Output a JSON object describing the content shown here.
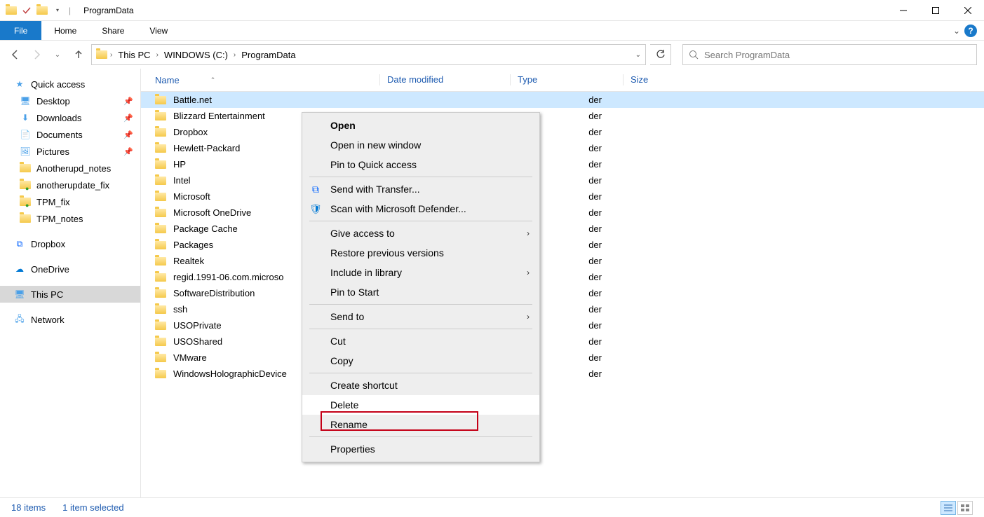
{
  "window": {
    "title": "ProgramData"
  },
  "ribbon": {
    "file": "File",
    "tabs": [
      "Home",
      "Share",
      "View"
    ]
  },
  "breadcrumb": [
    "This PC",
    "WINDOWS (C:)",
    "ProgramData"
  ],
  "search": {
    "placeholder": "Search ProgramData"
  },
  "sidebar": {
    "quick_access": {
      "label": "Quick access",
      "items": [
        {
          "label": "Desktop",
          "pinned": true,
          "icon": "desktop"
        },
        {
          "label": "Downloads",
          "pinned": true,
          "icon": "downloads"
        },
        {
          "label": "Documents",
          "pinned": true,
          "icon": "documents"
        },
        {
          "label": "Pictures",
          "pinned": true,
          "icon": "pictures"
        },
        {
          "label": "Anotherupd_notes",
          "pinned": false,
          "icon": "folder"
        },
        {
          "label": "anotherupdate_fix",
          "pinned": false,
          "icon": "folder-check"
        },
        {
          "label": "TPM_fix",
          "pinned": false,
          "icon": "folder-check"
        },
        {
          "label": "TPM_notes",
          "pinned": false,
          "icon": "folder"
        }
      ]
    },
    "dropbox": {
      "label": "Dropbox"
    },
    "onedrive": {
      "label": "OneDrive"
    },
    "this_pc": {
      "label": "This PC"
    },
    "network": {
      "label": "Network"
    }
  },
  "columns": {
    "name": "Name",
    "date": "Date modified",
    "type": "Type",
    "size": "Size"
  },
  "files": [
    {
      "name": "Battle.net",
      "type_suffix": "der",
      "selected": true
    },
    {
      "name": "Blizzard Entertainment",
      "type_suffix": "der"
    },
    {
      "name": "Dropbox",
      "type_suffix": "der"
    },
    {
      "name": "Hewlett-Packard",
      "type_suffix": "der"
    },
    {
      "name": "HP",
      "type_suffix": "der"
    },
    {
      "name": "Intel",
      "type_suffix": "der"
    },
    {
      "name": "Microsoft",
      "type_suffix": "der"
    },
    {
      "name": "Microsoft OneDrive",
      "type_suffix": "der"
    },
    {
      "name": "Package Cache",
      "type_suffix": "der"
    },
    {
      "name": "Packages",
      "type_suffix": "der"
    },
    {
      "name": "Realtek",
      "type_suffix": "der"
    },
    {
      "name": "regid.1991-06.com.microso",
      "type_suffix": "der"
    },
    {
      "name": "SoftwareDistribution",
      "type_suffix": "der"
    },
    {
      "name": "ssh",
      "type_suffix": "der"
    },
    {
      "name": "USOPrivate",
      "type_suffix": "der"
    },
    {
      "name": "USOShared",
      "type_suffix": "der"
    },
    {
      "name": "VMware",
      "type_suffix": "der"
    },
    {
      "name": "WindowsHolographicDevice",
      "type_suffix": "der"
    }
  ],
  "context_menu": {
    "open": "Open",
    "open_new_window": "Open in new window",
    "pin_quick_access": "Pin to Quick access",
    "send_transfer": "Send with Transfer...",
    "scan_defender": "Scan with Microsoft Defender...",
    "give_access": "Give access to",
    "restore_previous": "Restore previous versions",
    "include_library": "Include in library",
    "pin_start": "Pin to Start",
    "send_to": "Send to",
    "cut": "Cut",
    "copy": "Copy",
    "create_shortcut": "Create shortcut",
    "delete": "Delete",
    "rename": "Rename",
    "properties": "Properties"
  },
  "statusbar": {
    "items": "18 items",
    "selected": "1 item selected"
  }
}
